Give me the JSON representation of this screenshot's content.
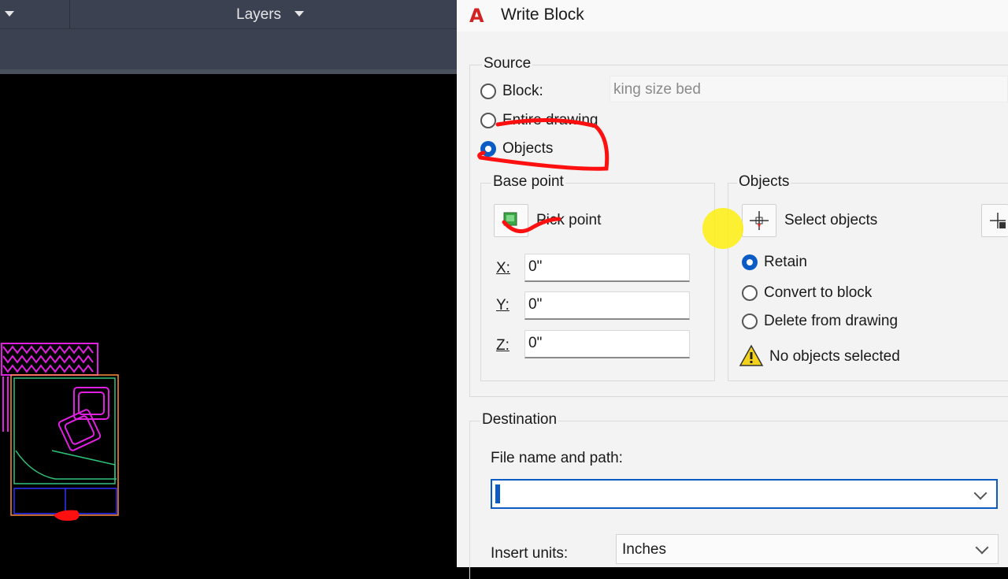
{
  "cad": {
    "layers_label": "Layers"
  },
  "dialog": {
    "title": "Write Block",
    "logo": "A",
    "source": {
      "label": "Source",
      "options": [
        {
          "label": "Block:",
          "selected": false
        },
        {
          "label": "Entire drawing",
          "selected": false
        },
        {
          "label": "Objects",
          "selected": true
        }
      ],
      "block_value": "king size bed"
    },
    "base_point": {
      "label": "Base point",
      "pick_point_label": "Pick point",
      "x_label": "X:",
      "x_value": "0\"",
      "y_label": "Y:",
      "y_value": "0\"",
      "z_label": "Z:",
      "z_value": "0\""
    },
    "objects": {
      "label": "Objects",
      "select_objects_label": "Select objects",
      "options": [
        {
          "label": "Retain",
          "selected": true
        },
        {
          "label": "Convert to block",
          "selected": false
        },
        {
          "label": "Delete from drawing",
          "selected": false
        }
      ],
      "status": "No objects selected"
    },
    "destination": {
      "label": "Destination",
      "file_label": "File name and path:",
      "file_value": "",
      "units_label": "Insert units:",
      "units_value": "Inches"
    }
  },
  "colors": {
    "accent": "#0a5bc4",
    "annotation_red": "#ff1010",
    "cursor_highlight": "#ffee00",
    "cad_magenta": "#e020e0",
    "cad_green": "#2fc27a"
  }
}
